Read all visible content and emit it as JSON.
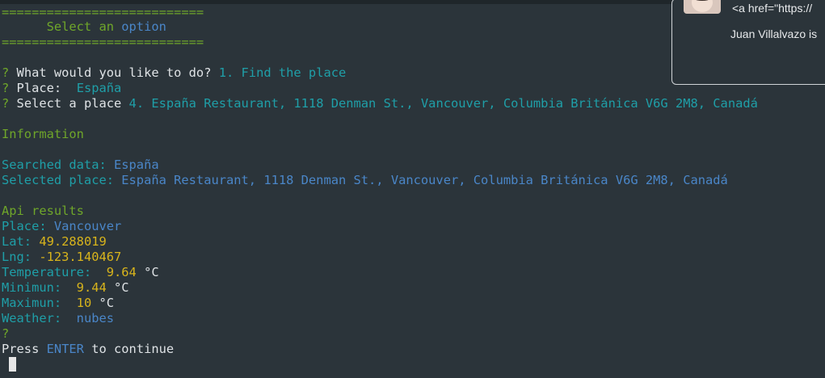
{
  "terminal": {
    "separator": "===========================",
    "menu_title_prefix": "      Select an ",
    "menu_title_word": "option",
    "prompts": [
      {
        "mark": "?",
        "question": " What would you like to do? ",
        "answer": "1. Find the place"
      },
      {
        "mark": "?",
        "question": " Place:  ",
        "answer": "España"
      },
      {
        "mark": "?",
        "question": " Select a place ",
        "answer": "4. España Restaurant, 1118 Denman St., Vancouver, Columbia Británica V6G 2M8, Canadá"
      }
    ],
    "info_heading": "Information",
    "searched_label": "Searched data: ",
    "searched_value": "España",
    "selected_label": "Selected place: ",
    "selected_value": "España Restaurant, 1118 Denman St., Vancouver, Columbia Británica V6G 2M8, Canadá",
    "api_heading": "Api results",
    "place_label": "Place: ",
    "place_value": "Vancouver",
    "lat_label": "Lat: ",
    "lat_value": "49.288019",
    "lng_label": "Lng: ",
    "lng_value": "-123.140467",
    "temp_label": "Temperature:  ",
    "temp_value": "9.64",
    "min_label": "Minimun:  ",
    "min_value": "9.44",
    "max_label": "Maximun:  ",
    "max_value": "10",
    "unit": " °C",
    "weather_label": "Weather:  ",
    "weather_value": "nubes",
    "final_mark": "?",
    "press_prefix": "Press ",
    "press_key": "ENTER",
    "press_suffix": " to continue"
  },
  "notification": {
    "html_snippet": "<a href=\"https://",
    "sender_text": "Juan Villalvazo is"
  }
}
